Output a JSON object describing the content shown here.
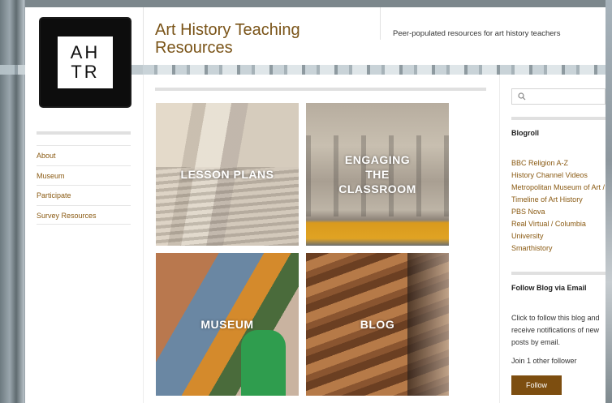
{
  "logo": {
    "line1": "AH",
    "line2": "TR"
  },
  "header": {
    "site_title": "Art History Teaching Resources",
    "tagline": "Peer-populated resources for art history teachers"
  },
  "nav": {
    "items": [
      {
        "label": "About"
      },
      {
        "label": "Museum"
      },
      {
        "label": "Participate"
      },
      {
        "label": "Survey Resources"
      }
    ]
  },
  "tiles": [
    {
      "label": "LESSON PLANS"
    },
    {
      "label": "ENGAGING\nTHE\nCLASSROOM"
    },
    {
      "label": "MUSEUM"
    },
    {
      "label": "BLOG"
    }
  ],
  "sidebar": {
    "search": {
      "placeholder": "",
      "value": ""
    },
    "blogroll_heading": "Blogroll",
    "blogroll_links": [
      {
        "label": "BBC Religion A-Z"
      },
      {
        "label": "History Channel Videos"
      },
      {
        "label": "Metropolitan Museum of Art / Timeline of Art History"
      },
      {
        "label": "PBS Nova"
      },
      {
        "label": "Real Virtual / Columbia University"
      },
      {
        "label": "Smarthistory"
      }
    ],
    "follow_heading": "Follow Blog via Email",
    "follow_text": "Click to follow this blog and receive notifications of new posts by email.",
    "join_text": "Join 1 other follower",
    "follow_button": "Follow"
  },
  "colors": {
    "accent": "#8a5a12",
    "button": "#7d4e10",
    "title": "#7a5418"
  }
}
